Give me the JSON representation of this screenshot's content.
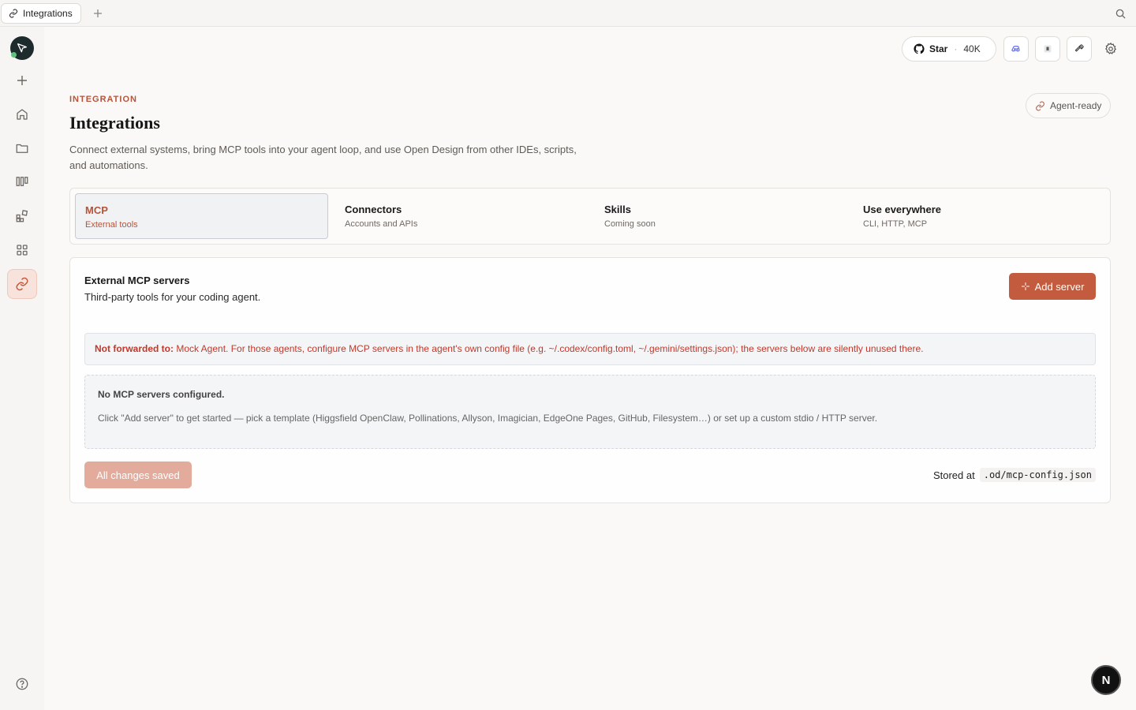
{
  "tabstrip": {
    "tab_label": "Integrations"
  },
  "header": {
    "star_label": "Star",
    "star_count": "40K"
  },
  "page": {
    "eyebrow": "INTEGRATION",
    "title": "Integrations",
    "description": "Connect external systems, bring MCP tools into your agent loop, and use Open Design from other IDEs, scripts, and automations.",
    "agent_ready_label": "Agent-ready"
  },
  "tabs": [
    {
      "title": "MCP",
      "subtitle": "External tools"
    },
    {
      "title": "Connectors",
      "subtitle": "Accounts and APIs"
    },
    {
      "title": "Skills",
      "subtitle": "Coming soon"
    },
    {
      "title": "Use everywhere",
      "subtitle": "CLI, HTTP, MCP"
    }
  ],
  "mcp": {
    "title": "External MCP servers",
    "subtitle": "Third-party tools for your coding agent.",
    "add_button": "Add server",
    "warning_label": "Not forwarded to:",
    "warning_text": " Mock Agent. For those agents, configure MCP servers in the agent's own config file (e.g. ~/.codex/config.toml, ~/.gemini/settings.json); the servers below are silently unused there.",
    "empty_title": "No MCP servers configured.",
    "empty_desc": "Click \"Add server\" to get started — pick a template (Higgsfield OpenClaw, Pollinations, Allyson, Imagician, EdgeOne Pages, GitHub, Filesystem…) or set up a custom stdio / HTTP server.",
    "saved_label": "All changes saved",
    "stored_label": "Stored at",
    "stored_path": ".od/mcp-config.json"
  },
  "fab_label": "N",
  "colors": {
    "accent": "#c35c3e",
    "accent_text": "#b5543a",
    "warning": "#c0392b"
  }
}
